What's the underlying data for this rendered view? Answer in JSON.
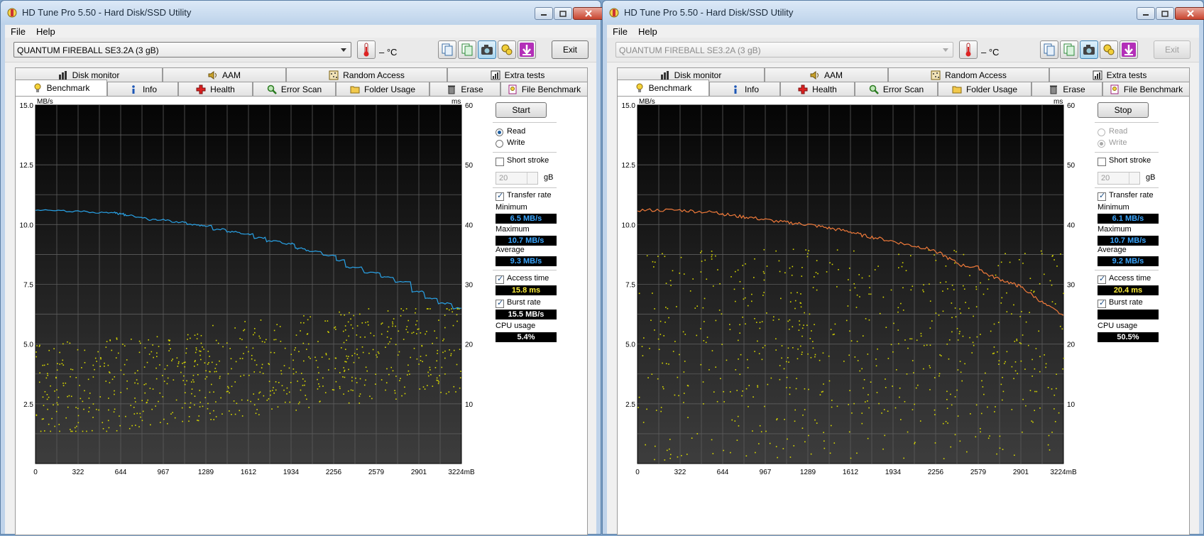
{
  "windows": [
    {
      "title": "HD Tune Pro 5.50 - Hard Disk/SSD Utility",
      "menu": [
        "File",
        "Help"
      ],
      "drive": "QUANTUM FIREBALL SE3.2A (3 gB)",
      "drive_disabled": false,
      "temperature": "– °C",
      "exit_label": "Exit",
      "exit_disabled": false,
      "tabs_top": [
        {
          "label": "Disk monitor",
          "icon": "disk-monitor-icon"
        },
        {
          "label": "AAM",
          "icon": "speaker-icon"
        },
        {
          "label": "Random Access",
          "icon": "random-access-icon"
        },
        {
          "label": "Extra tests",
          "icon": "extra-tests-icon"
        }
      ],
      "tabs_bottom": [
        {
          "label": "Benchmark",
          "icon": "lightbulb-icon",
          "active": true
        },
        {
          "label": "Info",
          "icon": "info-icon"
        },
        {
          "label": "Health",
          "icon": "health-cross-icon"
        },
        {
          "label": "Error Scan",
          "icon": "magnifier-icon"
        },
        {
          "label": "Folder Usage",
          "icon": "folder-icon"
        },
        {
          "label": "Erase",
          "icon": "trash-icon"
        },
        {
          "label": "File Benchmark",
          "icon": "file-benchmark-icon"
        }
      ],
      "panel": {
        "action_label": "Start",
        "read_label": "Read",
        "write_label": "Write",
        "mode": "read",
        "mode_disabled": false,
        "short_stroke_label": "Short stroke",
        "short_stroke_checked": false,
        "stroke_value": "20",
        "stroke_unit": "gB",
        "transfer_rate_label": "Transfer rate",
        "transfer_rate_checked": true,
        "minimum_label": "Minimum",
        "minimum_value": "6.5 MB/s",
        "maximum_label": "Maximum",
        "maximum_value": "10.7 MB/s",
        "average_label": "Average",
        "average_value": "9.3 MB/s",
        "access_time_label": "Access time",
        "access_time_checked": true,
        "access_time_value": "15.8 ms",
        "burst_rate_label": "Burst rate",
        "burst_rate_checked": true,
        "burst_rate_value": "15.5 MB/s",
        "cpu_usage_label": "CPU usage",
        "cpu_usage_value": "5.4%"
      },
      "chart_data": {
        "type": "line",
        "y_label": "MB/s",
        "y2_label": "ms",
        "x_unit": "mB",
        "y_ticks": [
          "15.0",
          "12.5",
          "10.0",
          "7.5",
          "5.0",
          "2.5"
        ],
        "y2_ticks": [
          "60",
          "50",
          "40",
          "30",
          "20",
          "10"
        ],
        "x_ticks": [
          "0",
          "322",
          "644",
          "967",
          "1289",
          "1612",
          "1934",
          "2256",
          "2579",
          "2901",
          "3224mB"
        ],
        "xlim": [
          0,
          3224
        ],
        "ylim": [
          0,
          15
        ],
        "y2lim": [
          0,
          60
        ],
        "grid": true,
        "line_color": "#29a3e8",
        "dot_color": "#d8d800",
        "transfer_series": {
          "name": "Transfer rate",
          "x": [
            0,
            150,
            322,
            500,
            600,
            644,
            700,
            800,
            900,
            967,
            1100,
            1200,
            1289,
            1400,
            1500,
            1612,
            1700,
            1800,
            1934,
            2000,
            2100,
            2256,
            2300,
            2400,
            2579,
            2650,
            2800,
            2901,
            3000,
            3100,
            3224
          ],
          "y": [
            10.6,
            10.6,
            10.55,
            10.5,
            10.5,
            10.45,
            10.4,
            10.3,
            10.2,
            10.2,
            10.1,
            10.0,
            9.95,
            9.8,
            9.7,
            9.6,
            9.45,
            9.3,
            9.2,
            9.0,
            8.9,
            8.7,
            8.5,
            8.2,
            8.0,
            7.8,
            7.6,
            7.2,
            6.9,
            6.7,
            6.5
          ]
        },
        "access_time_ms": {
          "mean": 15.8,
          "min": 5.5,
          "max": 26
        }
      }
    },
    {
      "title": "HD Tune Pro 5.50 - Hard Disk/SSD Utility",
      "menu": [
        "File",
        "Help"
      ],
      "drive": "QUANTUM FIREBALL SE3.2A (3 gB)",
      "drive_disabled": true,
      "temperature": "– °C",
      "exit_label": "Exit",
      "exit_disabled": true,
      "tabs_top": [
        {
          "label": "Disk monitor",
          "icon": "disk-monitor-icon"
        },
        {
          "label": "AAM",
          "icon": "speaker-icon"
        },
        {
          "label": "Random Access",
          "icon": "random-access-icon"
        },
        {
          "label": "Extra tests",
          "icon": "extra-tests-icon"
        }
      ],
      "tabs_bottom": [
        {
          "label": "Benchmark",
          "icon": "lightbulb-icon",
          "active": true
        },
        {
          "label": "Info",
          "icon": "info-icon"
        },
        {
          "label": "Health",
          "icon": "health-cross-icon"
        },
        {
          "label": "Error Scan",
          "icon": "magnifier-icon"
        },
        {
          "label": "Folder Usage",
          "icon": "folder-icon"
        },
        {
          "label": "Erase",
          "icon": "trash-icon"
        },
        {
          "label": "File Benchmark",
          "icon": "file-benchmark-icon"
        }
      ],
      "panel": {
        "action_label": "Stop",
        "read_label": "Read",
        "write_label": "Write",
        "mode": "write",
        "mode_disabled": true,
        "short_stroke_label": "Short stroke",
        "short_stroke_checked": false,
        "stroke_value": "20",
        "stroke_unit": "gB",
        "transfer_rate_label": "Transfer rate",
        "transfer_rate_checked": true,
        "minimum_label": "Minimum",
        "minimum_value": "6.1 MB/s",
        "maximum_label": "Maximum",
        "maximum_value": "10.7 MB/s",
        "average_label": "Average",
        "average_value": "9.2 MB/s",
        "access_time_label": "Access time",
        "access_time_checked": true,
        "access_time_value": "20.4 ms",
        "burst_rate_label": "Burst rate",
        "burst_rate_checked": true,
        "burst_rate_value": "",
        "cpu_usage_label": "CPU usage",
        "cpu_usage_value": "50.5%"
      },
      "chart_data": {
        "type": "line",
        "y_label": "MB/s",
        "y2_label": "ms",
        "x_unit": "mB",
        "y_ticks": [
          "15.0",
          "12.5",
          "10.0",
          "7.5",
          "5.0",
          "2.5"
        ],
        "y2_ticks": [
          "60",
          "50",
          "40",
          "30",
          "20",
          "10"
        ],
        "x_ticks": [
          "0",
          "322",
          "644",
          "967",
          "1289",
          "1612",
          "1934",
          "2256",
          "2579",
          "2901",
          "3224mB"
        ],
        "xlim": [
          0,
          3224
        ],
        "ylim": [
          0,
          15
        ],
        "y2lim": [
          0,
          60
        ],
        "grid": true,
        "line_color": "#f07a3a",
        "dot_color": "#d8d800",
        "transfer_series": {
          "name": "Transfer rate",
          "x": [
            0,
            150,
            322,
            450,
            600,
            644,
            750,
            850,
            967,
            1100,
            1200,
            1289,
            1400,
            1500,
            1612,
            1700,
            1800,
            1934,
            2050,
            2150,
            2256,
            2350,
            2450,
            2579,
            2650,
            2750,
            2850,
            2901,
            3000,
            3100,
            3224
          ],
          "y": [
            10.6,
            10.6,
            10.6,
            10.55,
            10.5,
            10.45,
            10.35,
            10.3,
            10.2,
            10.1,
            10.05,
            10.0,
            9.9,
            9.8,
            9.7,
            9.55,
            9.45,
            9.3,
            9.15,
            9.05,
            8.9,
            8.6,
            8.3,
            8.2,
            7.9,
            7.7,
            7.5,
            7.4,
            7.0,
            6.6,
            6.2
          ]
        },
        "access_time_ms": {
          "mean": 20.4,
          "min": 0.5,
          "max": 36
        }
      }
    }
  ]
}
